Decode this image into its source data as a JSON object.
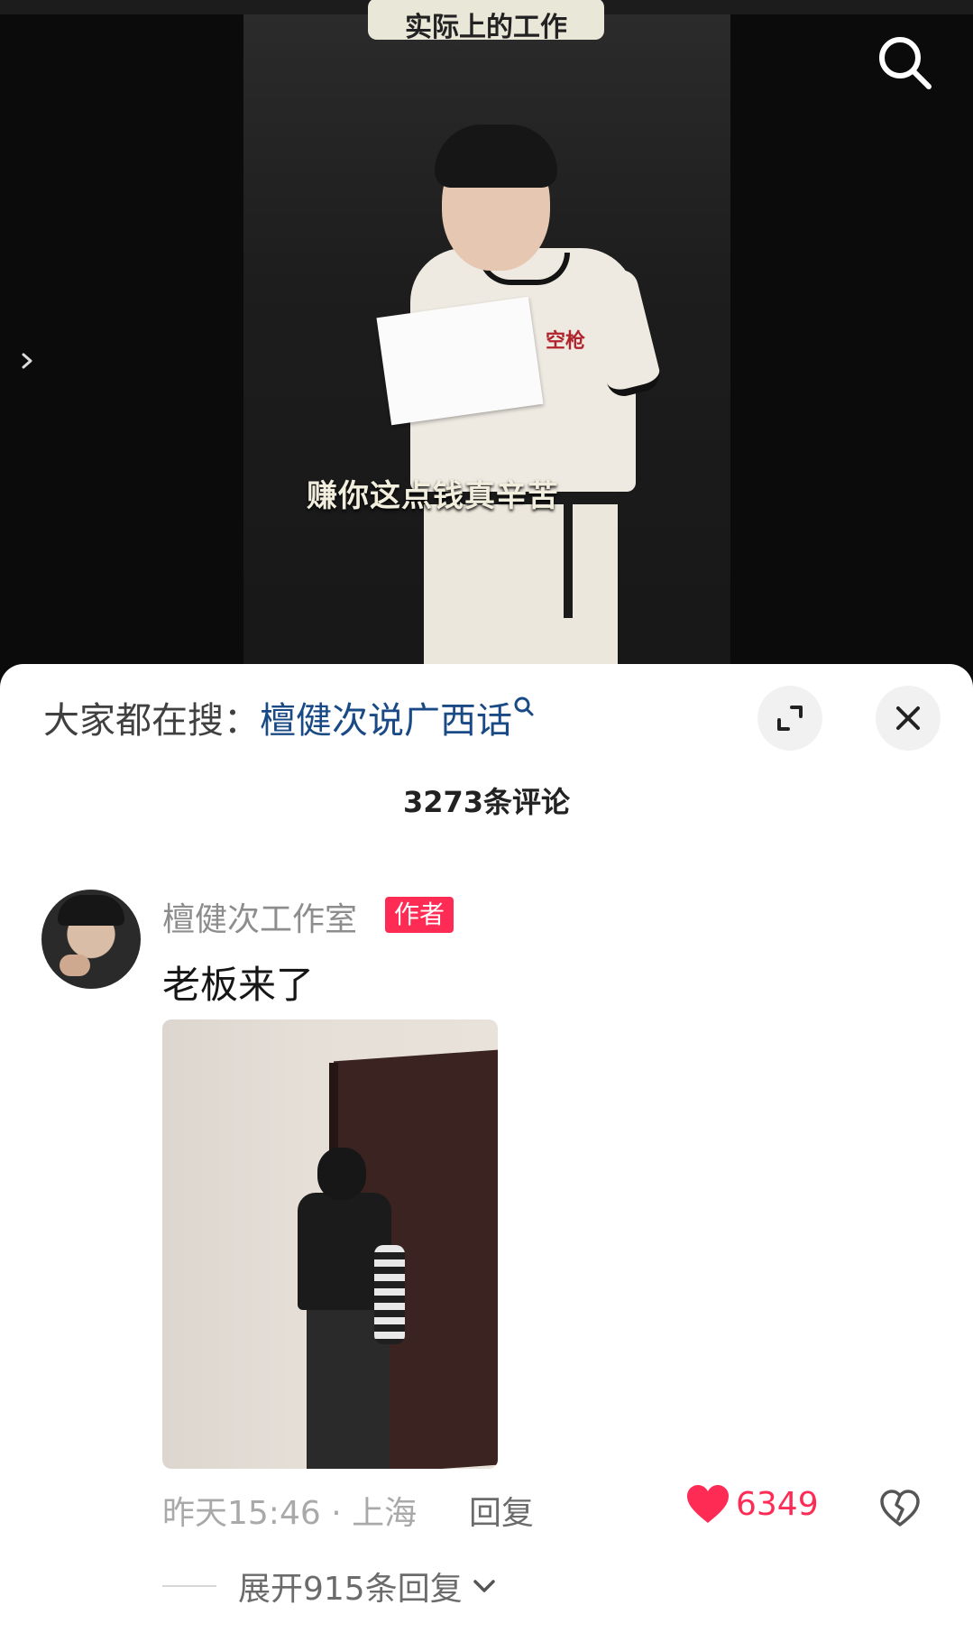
{
  "video": {
    "top_caption": "实际上的工作",
    "subtitle": "赚你这点钱真辛苦",
    "shirt_logo": "空枪"
  },
  "search_suggest": {
    "prefix": "大家都在搜：",
    "query": "檀健次说广西话"
  },
  "comments": {
    "count_label": "3273条评论",
    "items": [
      {
        "username": "檀健次工作室",
        "badge": "作者",
        "text": "老板来了",
        "meta": "昨天15:46 · 上海",
        "reply_label": "回复",
        "likes": "6349",
        "expand_label": "展开915条回复"
      }
    ]
  },
  "colors": {
    "accent": "#fe2c55",
    "query_link": "#1a4a85"
  },
  "icons": [
    "search-icon",
    "chevron-right-icon",
    "expand-icon",
    "close-icon",
    "heart-icon",
    "dislike-icon",
    "chevron-down-icon"
  ]
}
